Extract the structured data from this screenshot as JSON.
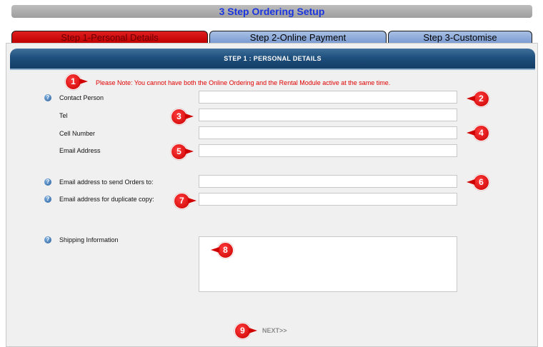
{
  "title": "3 Step Ordering Setup",
  "tabs": [
    {
      "label": "Step 1-Personal Details",
      "active": true
    },
    {
      "label": "Step 2-Online Payment",
      "active": false
    },
    {
      "label": "Step 3-Customise",
      "active": false
    }
  ],
  "panel": {
    "header": "STEP 1 : PERSONAL DETAILS",
    "note": "Please Note: You cannot have both the Online Ordering and the Rental Module active at the same time."
  },
  "fields": {
    "contact_person": {
      "label": "Contact Person",
      "value": ""
    },
    "tel": {
      "label": "Tel",
      "value": ""
    },
    "cell_number": {
      "label": "Cell Number",
      "value": ""
    },
    "email_address": {
      "label": "Email Address",
      "value": ""
    },
    "orders_email": {
      "label": "Email address to send Orders to:",
      "value": ""
    },
    "duplicate_email": {
      "label": "Email address for duplicate copy:",
      "value": ""
    },
    "shipping_info": {
      "label": "Shipping Information",
      "value": ""
    }
  },
  "help_icon": "?",
  "next_label": "NEXT>>",
  "markers": [
    "1",
    "2",
    "3",
    "4",
    "5",
    "6",
    "7",
    "8",
    "9"
  ],
  "colors": {
    "title_text": "#1a35e0",
    "active_tab": "#d00000",
    "inactive_tab": "#7b9bd2",
    "panel_header": "#1f4f7c",
    "note_text": "#e00000",
    "marker": "#d00000"
  }
}
